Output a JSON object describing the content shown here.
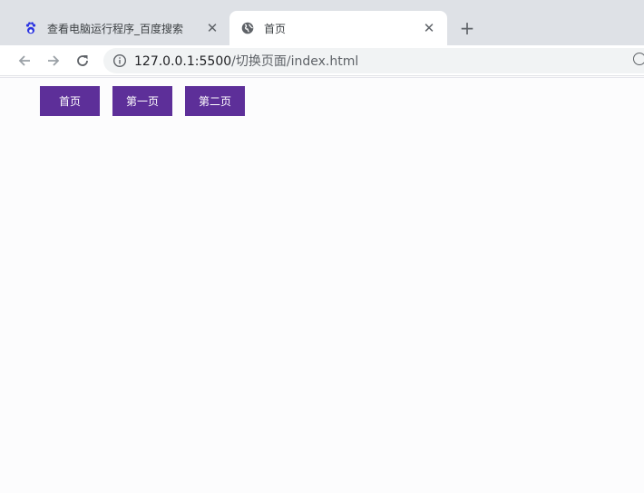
{
  "browser": {
    "tabs": [
      {
        "title": "查看电脑运行程序_百度搜索",
        "favicon": "baidu-paw-icon",
        "active": false
      },
      {
        "title": "首页",
        "favicon": "globe-icon",
        "active": true
      }
    ],
    "new_tab_label": "+",
    "close_label": "✕",
    "url_host": "127.0.0.1:5500",
    "url_path": "/切换页面/index.html"
  },
  "page": {
    "buttons": [
      {
        "label": "首页"
      },
      {
        "label": "第一页"
      },
      {
        "label": "第二页"
      }
    ]
  },
  "colors": {
    "button_bg": "#5d2f99",
    "button_text": "#ffffff",
    "tab_strip": "#dee1e6",
    "omnibox": "#f1f3f4"
  }
}
